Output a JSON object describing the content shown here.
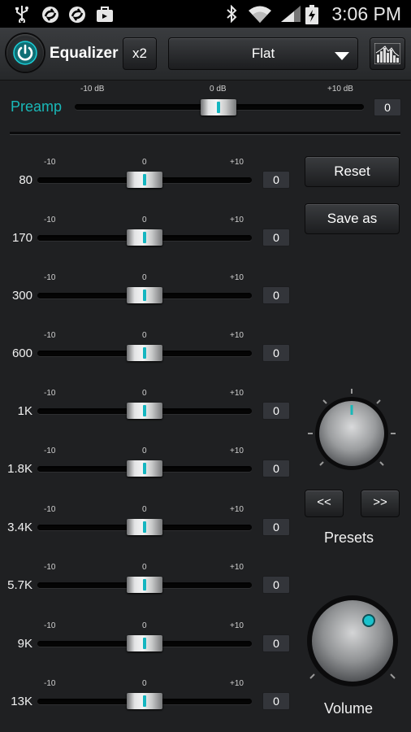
{
  "status_bar": {
    "time": "3:06 PM",
    "left_icons": [
      "usb-icon",
      "sync-icon",
      "sync-icon",
      "shopping-bag-icon"
    ],
    "right_icons": [
      "bluetooth-icon",
      "wifi-icon",
      "signal-icon",
      "battery-charging-icon"
    ]
  },
  "header": {
    "title": "Equalizer",
    "x2_label": "x2",
    "preset_selected": "Flat"
  },
  "preamp": {
    "label": "Preamp",
    "scale": [
      "-10 dB",
      "0 dB",
      "+10 dB"
    ],
    "value": "0"
  },
  "band_scale": [
    "-10",
    "0",
    "+10"
  ],
  "bands": [
    {
      "label": "80",
      "value": "0"
    },
    {
      "label": "170",
      "value": "0"
    },
    {
      "label": "300",
      "value": "0"
    },
    {
      "label": "600",
      "value": "0"
    },
    {
      "label": "1K",
      "value": "0"
    },
    {
      "label": "1.8K",
      "value": "0"
    },
    {
      "label": "3.4K",
      "value": "0"
    },
    {
      "label": "5.7K",
      "value": "0"
    },
    {
      "label": "9K",
      "value": "0"
    },
    {
      "label": "13K",
      "value": "0"
    }
  ],
  "actions": {
    "reset_label": "Reset",
    "save_as_label": "Save as"
  },
  "presets_knob": {
    "label": "Presets",
    "prev_label": "<<",
    "next_label": ">>"
  },
  "volume_knob": {
    "label": "Volume"
  },
  "colors": {
    "accent": "#19b8b8",
    "background": "#1f2022"
  }
}
